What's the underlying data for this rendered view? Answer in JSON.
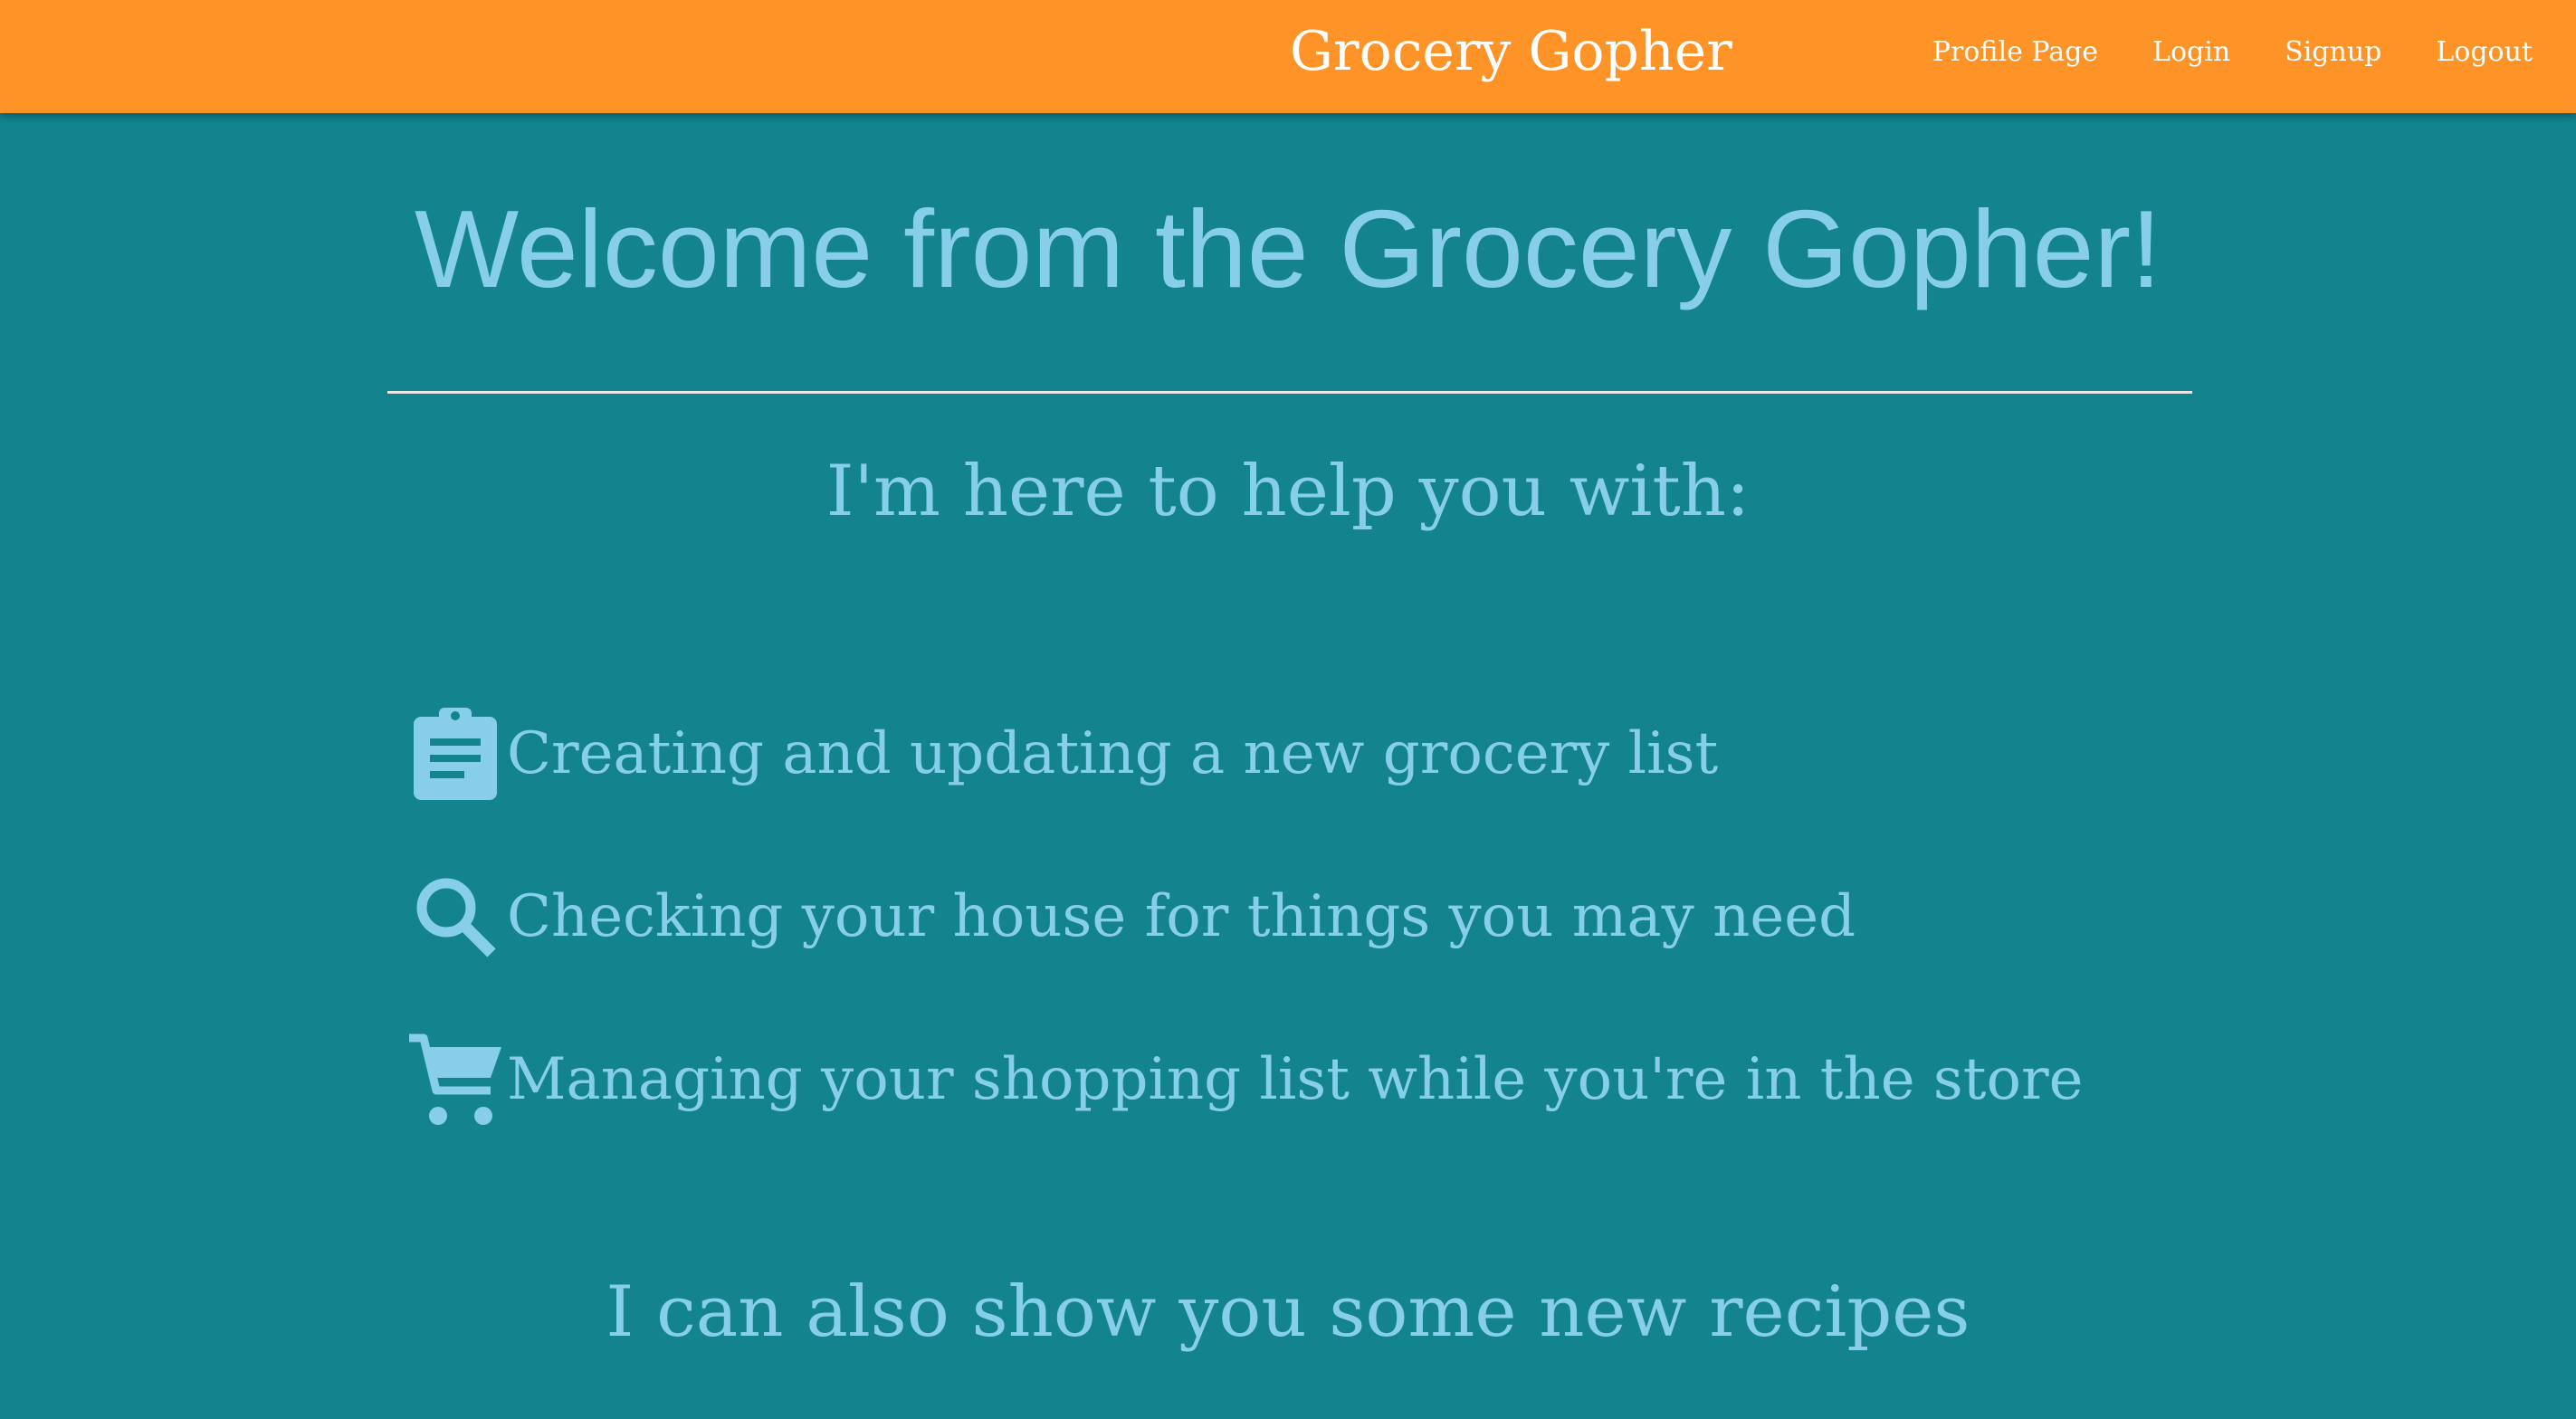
{
  "navbar": {
    "brand": "Grocery Gopher",
    "links": [
      {
        "label": "Profile Page"
      },
      {
        "label": "Login"
      },
      {
        "label": "Signup"
      },
      {
        "label": "Logout"
      }
    ],
    "background": "#fe9428"
  },
  "main": {
    "title": "Welcome from the Grocery Gopher!",
    "subtitle": "I'm here to help you with:",
    "features": [
      {
        "icon": "clipboard-icon",
        "text": "Creating and updating a new grocery list"
      },
      {
        "icon": "search-icon",
        "text": "Checking your house for things you may need"
      },
      {
        "icon": "shopping-cart-icon",
        "text": "Managing your shopping list while you're in the store"
      }
    ],
    "recipes_line": "I can also show you some new recipes"
  },
  "colors": {
    "page_background": "#13838e",
    "accent_text": "#87ceeb",
    "navbar_text": "#ffffff"
  }
}
